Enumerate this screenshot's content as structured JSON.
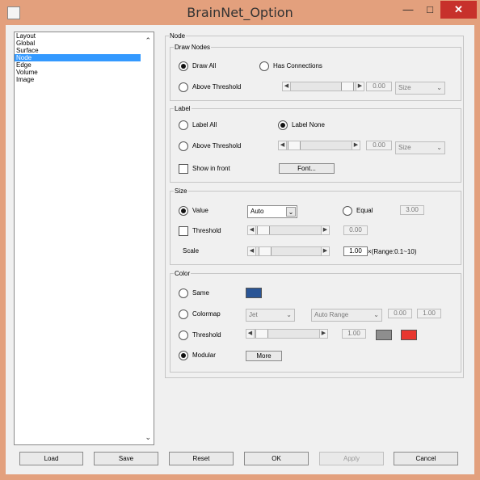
{
  "window": {
    "title": "BrainNet_Option",
    "minimize_glyph": "—",
    "maximize_glyph": "□",
    "close_glyph": "✕"
  },
  "sidebar": {
    "items": [
      {
        "label": "Layout"
      },
      {
        "label": "Global"
      },
      {
        "label": "Surface"
      },
      {
        "label": "Node",
        "selected": true
      },
      {
        "label": "Edge"
      },
      {
        "label": "Volume"
      },
      {
        "label": "Image"
      }
    ],
    "scroll_up": "⌃",
    "scroll_down": "⌄"
  },
  "node_panel": {
    "title": "Node",
    "draw_nodes": {
      "title": "Draw Nodes",
      "draw_all": "Draw All",
      "has_connections": "Has Connections",
      "above_threshold": "Above Threshold",
      "threshold_value": "0.00",
      "metric_select": "Size",
      "selected_option": "Draw All"
    },
    "label": {
      "title": "Label",
      "label_all": "Label All",
      "label_none": "Label None",
      "above_threshold": "Above Threshold",
      "threshold_value": "0.00",
      "metric_select": "Size",
      "show_in_front": "Show in front",
      "font_button": "Font...",
      "selected_option": "Label None"
    },
    "size": {
      "title": "Size",
      "value_label": "Value",
      "value_select": "Auto",
      "equal_label": "Equal",
      "equal_value": "3.00",
      "threshold_label": "Threshold",
      "threshold_value": "0.00",
      "scale_label": "Scale",
      "scale_value": "1.00",
      "scale_range": "×(Range:0.1~10)",
      "selected_option": "Value"
    },
    "color": {
      "title": "Color",
      "same_label": "Same",
      "same_color": "#2a5596",
      "colormap_label": "Colormap",
      "colormap_select": "Jet",
      "range_select": "Auto Range",
      "range_min": "0.00",
      "range_max": "1.00",
      "threshold_label": "Threshold",
      "threshold_value": "1.00",
      "low_color": "#8e8e8e",
      "high_color": "#e8372f",
      "modular_label": "Modular",
      "more_button": "More",
      "selected_option": "Modular"
    }
  },
  "footer": {
    "load": "Load",
    "save": "Save",
    "reset": "Reset",
    "ok": "OK",
    "apply": "Apply",
    "cancel": "Cancel"
  }
}
